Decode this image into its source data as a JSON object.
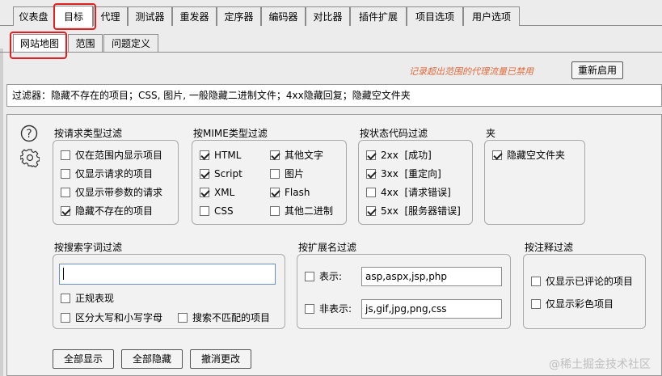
{
  "top_tabs": [
    "仪表盘",
    "目标",
    "代理",
    "测试器",
    "重发器",
    "定序器",
    "编码器",
    "对比器",
    "插件扩展",
    "项目选项",
    "用户选项"
  ],
  "sub_tabs": [
    "网站地图",
    "范围",
    "问题定义"
  ],
  "notice": "记录超出范围的代理流量已禁用",
  "reenable_button": "重新启用",
  "filter_summary": "过滤器：隐藏不存在的项目；CSS, 图片, 一般隐藏二进制文件；4xx隐藏回复；隐藏空文件夹",
  "request_type": {
    "title": "按请求类型过滤",
    "items": [
      {
        "label": "仅在范围内显示项目",
        "checked": false
      },
      {
        "label": "仅显示请求的项目",
        "checked": false
      },
      {
        "label": "仅显示带参数的请求",
        "checked": false
      },
      {
        "label": "隐藏不存在的项目",
        "checked": true
      }
    ]
  },
  "mime": {
    "title": "按MIME类型过滤",
    "items": [
      {
        "label": "HTML",
        "checked": true
      },
      {
        "label": "其他文字",
        "checked": true
      },
      {
        "label": "Script",
        "checked": true
      },
      {
        "label": "图片",
        "checked": false
      },
      {
        "label": "XML",
        "checked": true
      },
      {
        "label": "Flash",
        "checked": true
      },
      {
        "label": "CSS",
        "checked": false
      },
      {
        "label": "其他二进制",
        "checked": false
      }
    ]
  },
  "status": {
    "title": "按状态代码过滤",
    "items": [
      {
        "label": "2xx  [成功]",
        "checked": true
      },
      {
        "label": "3xx  [重定向]",
        "checked": true
      },
      {
        "label": "4xx  [请求错误]",
        "checked": false
      },
      {
        "label": "5xx  [服务器错误]",
        "checked": true
      }
    ]
  },
  "folder": {
    "title": "夹",
    "items": [
      {
        "label": "隐藏空文件夹",
        "checked": true
      }
    ]
  },
  "search": {
    "title": "按搜索字词过滤",
    "value": "",
    "regex": {
      "label": "正规表现",
      "checked": false
    },
    "case": {
      "label": "区分大写和小写字母",
      "checked": false
    },
    "negative": {
      "label": "搜索不匹配的项目",
      "checked": false
    }
  },
  "extension": {
    "title": "按扩展名过滤",
    "show": {
      "label": "表示:",
      "checked": false,
      "value": "asp,aspx,jsp,php"
    },
    "hide": {
      "label": "非表示:",
      "checked": false,
      "value": "js,gif,jpg,png,css"
    }
  },
  "annotation": {
    "title": "按注释过滤",
    "items": [
      {
        "label": "仅显示已评论的项目",
        "checked": false
      },
      {
        "label": "仅显示彩色项目",
        "checked": false
      }
    ]
  },
  "buttons": {
    "show_all": "全部显示",
    "hide_all": "全部隐藏",
    "revert": "撤消更改"
  },
  "watermark": "@稀土掘金技术社区"
}
